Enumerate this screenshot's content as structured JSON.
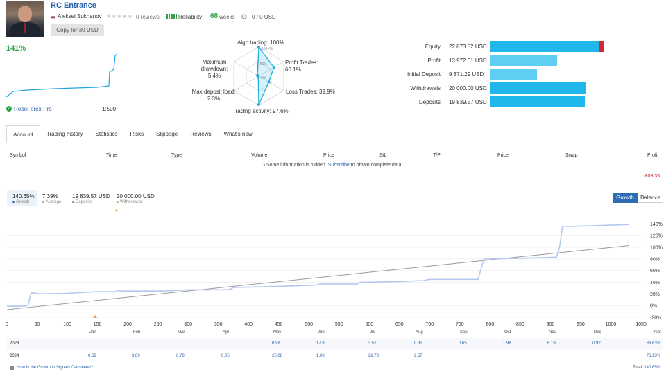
{
  "header": {
    "title": "RC Entrance",
    "author": "Aleksei Sukhanov",
    "stars": "★★★★★",
    "reviews": "0 reviews",
    "reliability": "Reliability",
    "weeks_num": "68",
    "weeks_label": "weeks",
    "subscribers_funds": "0 / 0 USD",
    "copy_button": "Copy for 30 USD",
    "growth": "141%",
    "broker": "RoboForex-Pro",
    "leverage": "1:500"
  },
  "colors": {
    "accent": "#2a62a8",
    "green": "#2ea34a",
    "bar": "#20b8ec",
    "bar_light": "#5ecff3",
    "red": "#d7262f",
    "line": "#b4c8ef"
  },
  "radar": {
    "labels": {
      "algo": "Algo trading: 100%",
      "profit": "Profit Trades:",
      "profit_v": "60.1%",
      "loss": "Loss Trades: 39.9%",
      "activity": "Trading activity: 97.6%",
      "load": "Max deposit load:",
      "load_v": "2.3%",
      "drawdown": "Maximum",
      "drawdown2": "drawdown: 5.4%",
      "t100": "100+%",
      "t50": "50%",
      "t0": "0%"
    },
    "values": {
      "algo": 100,
      "profit": 60.1,
      "loss": 39.9,
      "activity": 97.6,
      "load": 2.3,
      "drawdown": 5.4
    }
  },
  "equity": [
    {
      "label": "Equity",
      "value": "22 873.52 USD",
      "amount": 22873.52
    },
    {
      "label": "Profit",
      "value": "13 972.01 USD",
      "amount": 13972.01
    },
    {
      "label": "Initial Deposit",
      "value": "9 871.29 USD",
      "amount": 9871.29
    },
    {
      "label": "Withdrawals",
      "value": "20 000.00 USD",
      "amount": 20000
    },
    {
      "label": "Deposits",
      "value": "19 839.57 USD",
      "amount": 19839.57
    }
  ],
  "tabs": [
    "Account",
    "Trading history",
    "Statistics",
    "Risks",
    "Slippage",
    "Reviews",
    "What's new"
  ],
  "trade_table": {
    "headers": [
      "Symbol",
      "Time",
      "Type",
      "Volume",
      "Price",
      "S/L",
      "T/P",
      "Price",
      "Swap",
      "Profit"
    ],
    "info_pre": "Some information is hidden.",
    "info_link": "Subscribe",
    "info_post": "to obtain complete data.",
    "profit": "-809.35"
  },
  "stats": [
    {
      "value": "140.65%",
      "label": "Growth",
      "dot": "#2a62a8"
    },
    {
      "value": "7.39%",
      "label": "Average",
      "dot": "#999999"
    },
    {
      "value": "19 839.57 USD",
      "label": "Deposits",
      "dot": "#2ea34a"
    },
    {
      "value": "20 000.00 USD",
      "label": "Withdrawals",
      "dot": "#e8a040"
    }
  ],
  "chart_buttons": {
    "growth": "Growth",
    "balance": "Balance"
  },
  "chart_data": {
    "type": "line",
    "x_ticks": [
      "0",
      "50",
      "100",
      "150",
      "200",
      "250",
      "300",
      "350",
      "400",
      "450",
      "500",
      "550",
      "600",
      "650",
      "700",
      "750",
      "800",
      "850",
      "900",
      "950",
      "1000",
      "1050"
    ],
    "y_ticks": [
      "140%",
      "120%",
      "100%",
      "80%",
      "60%",
      "40%",
      "20%",
      "0%",
      "-20%"
    ],
    "xlim": [
      0,
      1050
    ],
    "ylim": [
      -20,
      150
    ],
    "series": [
      {
        "name": "Growth",
        "x": [
          0,
          30,
          35,
          40,
          55,
          100,
          150,
          180,
          185,
          190,
          260,
          300,
          360,
          370,
          375,
          450,
          510,
          520,
          580,
          585,
          640,
          690,
          695,
          700,
          780,
          790,
          800,
          910,
          915,
          920,
          940,
          1000,
          1030
        ],
        "y": [
          -1,
          -1,
          1,
          22,
          20,
          21,
          24,
          24,
          26,
          25,
          25,
          27,
          27,
          28,
          31,
          33,
          35,
          37,
          37,
          40,
          41,
          43,
          44,
          45,
          45,
          80,
          80,
          83,
          100,
          136,
          136,
          138,
          139
        ]
      },
      {
        "name": "Average",
        "x": [
          0,
          1030
        ],
        "y": [
          -7,
          103
        ]
      }
    ]
  },
  "monthly": {
    "months": [
      "Jan",
      "Feb",
      "Mar",
      "Apr",
      "May",
      "Jun",
      "Jul",
      "Aug",
      "Sep",
      "Oct",
      "Nov",
      "Dec",
      "Year"
    ],
    "rows": [
      {
        "year": "2023",
        "values": [
          "",
          "",
          "",
          "",
          "0.98",
          "17.8",
          "3.57",
          "0.82",
          "0.65",
          "1.98",
          "6.19",
          "0.92"
        ],
        "total": "36.63%"
      },
      {
        "year": "2024",
        "values": [
          "0.68",
          "3.89",
          "0.78",
          "0.05",
          "25.08",
          "1.03",
          "28.73",
          "2.67",
          "",
          "",
          "",
          ""
        ],
        "total": "76.13%"
      }
    ],
    "how_calc": "How is the Growth in Signals Calculated?",
    "total_label": "Total:",
    "total_value": "140.65%"
  }
}
